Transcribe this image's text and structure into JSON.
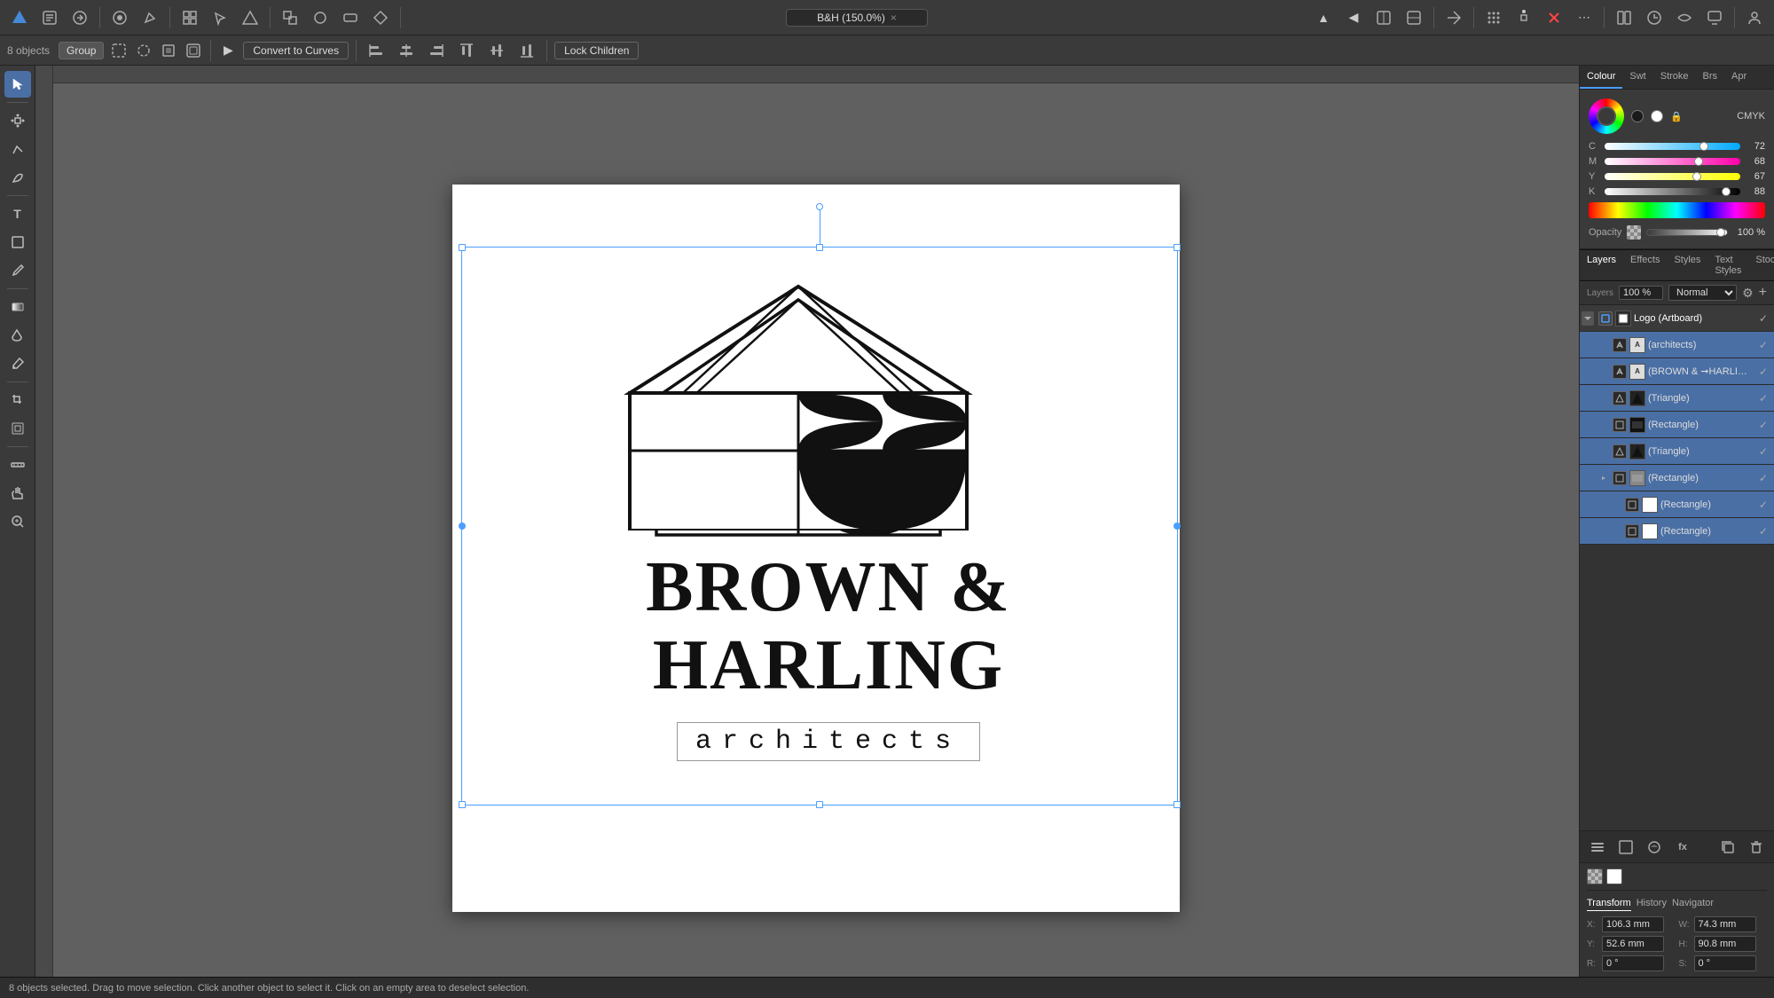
{
  "app": {
    "title": "B&H (150.0%)",
    "close_label": "×"
  },
  "top_toolbar": {
    "icons": [
      "◈",
      "⊞",
      "⇢",
      "⊕",
      "✦",
      "⬡",
      "⊛"
    ],
    "align_icons": [
      "←→",
      "↑↓",
      "⬛",
      "⬜",
      "⊞",
      "≡"
    ],
    "extra_icons": [
      "⊕",
      "✦",
      "⊛",
      "⊘",
      "⊙"
    ]
  },
  "second_toolbar": {
    "objects_count": "8 objects",
    "group_label": "Group",
    "convert_label": "Convert to Curves",
    "lock_label": "Lock Children"
  },
  "colour_panel": {
    "tabs": [
      "Colour",
      "Swt",
      "Stroke",
      "Brs",
      "Apr"
    ],
    "active_tab": "Colour",
    "mode": "CMYK",
    "c_value": "72",
    "m_value": "68",
    "y_value": "67",
    "k_value": "88",
    "c_label": "C",
    "m_label": "M",
    "y_label": "Y",
    "k_label": "K",
    "opacity_label": "Opacity",
    "opacity_value": "100 %"
  },
  "layers_panel": {
    "tabs": [
      "Layers",
      "Effects",
      "Styles",
      "Text Styles",
      "Stock"
    ],
    "active_tab": "Layers",
    "opacity_value": "100 %",
    "blend_mode": "Normal",
    "items": [
      {
        "name": "Logo (Artboard)",
        "type": "artboard",
        "level": 0,
        "visible": true,
        "checked": true,
        "expanded": true
      },
      {
        "name": "(architects)",
        "type": "text",
        "level": 1,
        "visible": true,
        "checked": true
      },
      {
        "name": "(BROWN & ➞HARLING)",
        "type": "text",
        "level": 1,
        "visible": true,
        "checked": true
      },
      {
        "name": "(Triangle)",
        "type": "shape",
        "level": 1,
        "visible": true,
        "checked": true
      },
      {
        "name": "(Rectangle)",
        "type": "shape",
        "level": 1,
        "visible": true,
        "checked": true
      },
      {
        "name": "(Triangle)",
        "type": "shape",
        "level": 1,
        "visible": true,
        "checked": true
      },
      {
        "name": "(Rectangle)",
        "type": "group",
        "level": 1,
        "visible": true,
        "checked": true,
        "expanded": true
      },
      {
        "name": "(Rectangle)",
        "type": "shape-white",
        "level": 2,
        "visible": true,
        "checked": true
      },
      {
        "name": "(Rectangle)",
        "type": "shape-white",
        "level": 2,
        "visible": true,
        "checked": true
      }
    ]
  },
  "transform_panel": {
    "tabs": [
      "Transform",
      "History",
      "Navigator"
    ],
    "active_tab": "Transform",
    "x_label": "X:",
    "x_value": "106.3 mm",
    "w_label": "W:",
    "w_value": "74.3 mm",
    "y_label": "Y:",
    "y_value": "52.6 mm",
    "h_label": "H:",
    "h_value": "90.8 mm",
    "r_label": "R:",
    "r_value": "0 °",
    "s_label": "S:",
    "s_value": "0 °"
  },
  "status_bar": {
    "text": "8 objects selected.",
    "drag_text": "Drag to move selection.",
    "click_text": "Click another object to select it.",
    "click2_text": "Click on an empty area to deselect selection."
  },
  "canvas": {
    "zoom": "150.0%",
    "logo_text_line1": "BROWN &",
    "logo_text_line2": "HARLING",
    "logo_text_line3": "architects"
  }
}
